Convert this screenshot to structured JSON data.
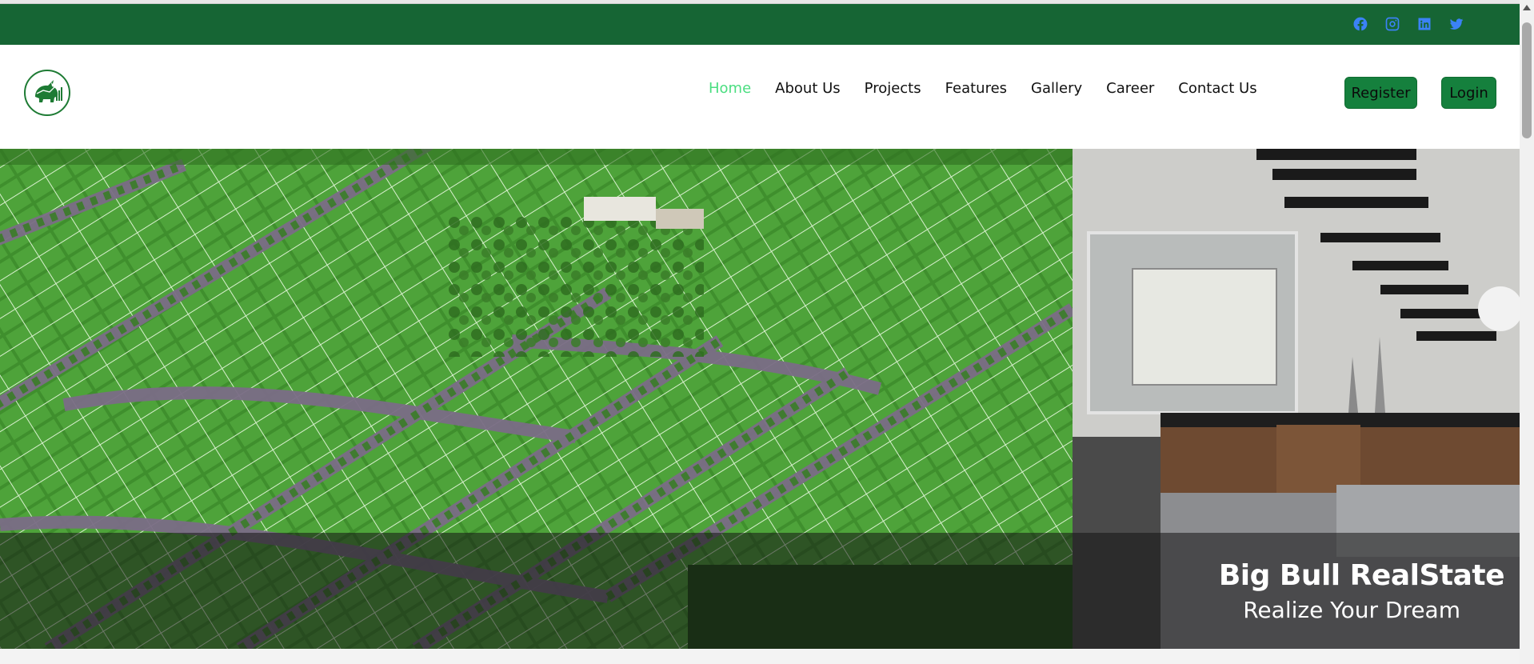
{
  "social": {
    "icons": [
      "facebook-icon",
      "instagram-icon",
      "linkedin-icon",
      "twitter-icon"
    ],
    "color": "#3b82f6"
  },
  "nav": {
    "items": [
      {
        "label": "Home",
        "active": true
      },
      {
        "label": "About Us",
        "active": false
      },
      {
        "label": "Projects",
        "active": false
      },
      {
        "label": "Features",
        "active": false
      },
      {
        "label": "Gallery",
        "active": false
      },
      {
        "label": "Career",
        "active": false
      },
      {
        "label": "Contact Us",
        "active": false
      }
    ],
    "register_label": "Register",
    "login_label": "Login"
  },
  "hero": {
    "title": "Big Bull RealState",
    "subtitle": "Realize Your Dream"
  },
  "colors": {
    "topbar": "#166534",
    "button": "#15803d",
    "active_link": "#4ade80"
  }
}
